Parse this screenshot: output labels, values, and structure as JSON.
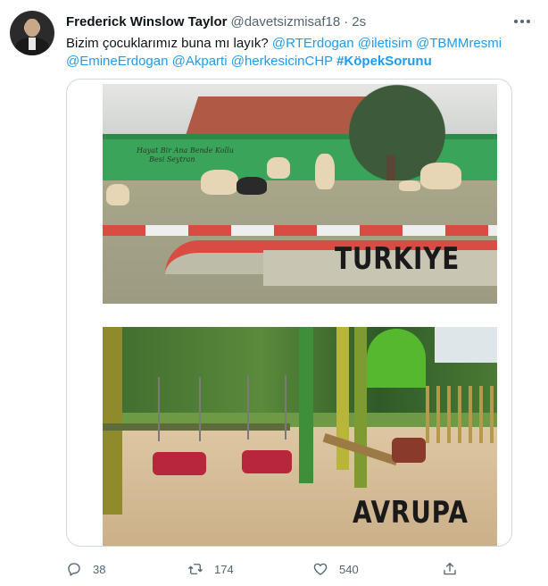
{
  "tweet": {
    "author_name": "Frederick Winslow Taylor",
    "handle": "@davetsizmisaf18",
    "separator": "·",
    "time": "2s",
    "text_prefix": "Bizim çocuklarımız buna mı layık? ",
    "mentions": [
      "@RTErdogan",
      "@iletisim",
      "@TBMMresmi",
      "@EmineErdogan",
      "@Akparti",
      "@herkesicinCHP"
    ],
    "hashtag": "#KöpekSorunu"
  },
  "media": {
    "image_top_label": "TURKIYE",
    "image_bottom_label": "AVRUPA",
    "graffiti_line1": "Hayat Bir Ana Bende Kollu",
    "graffiti_line2": "Besi Seytran"
  },
  "actions": {
    "reply_count": "38",
    "retweet_count": "174",
    "like_count": "540"
  },
  "icons": {
    "reply": "reply-icon",
    "retweet": "retweet-icon",
    "like": "heart-icon",
    "share": "share-icon",
    "more": "more-icon"
  },
  "colors": {
    "link": "#1d9bf0",
    "secondary_text": "#536471",
    "primary_text": "#0f1419"
  }
}
